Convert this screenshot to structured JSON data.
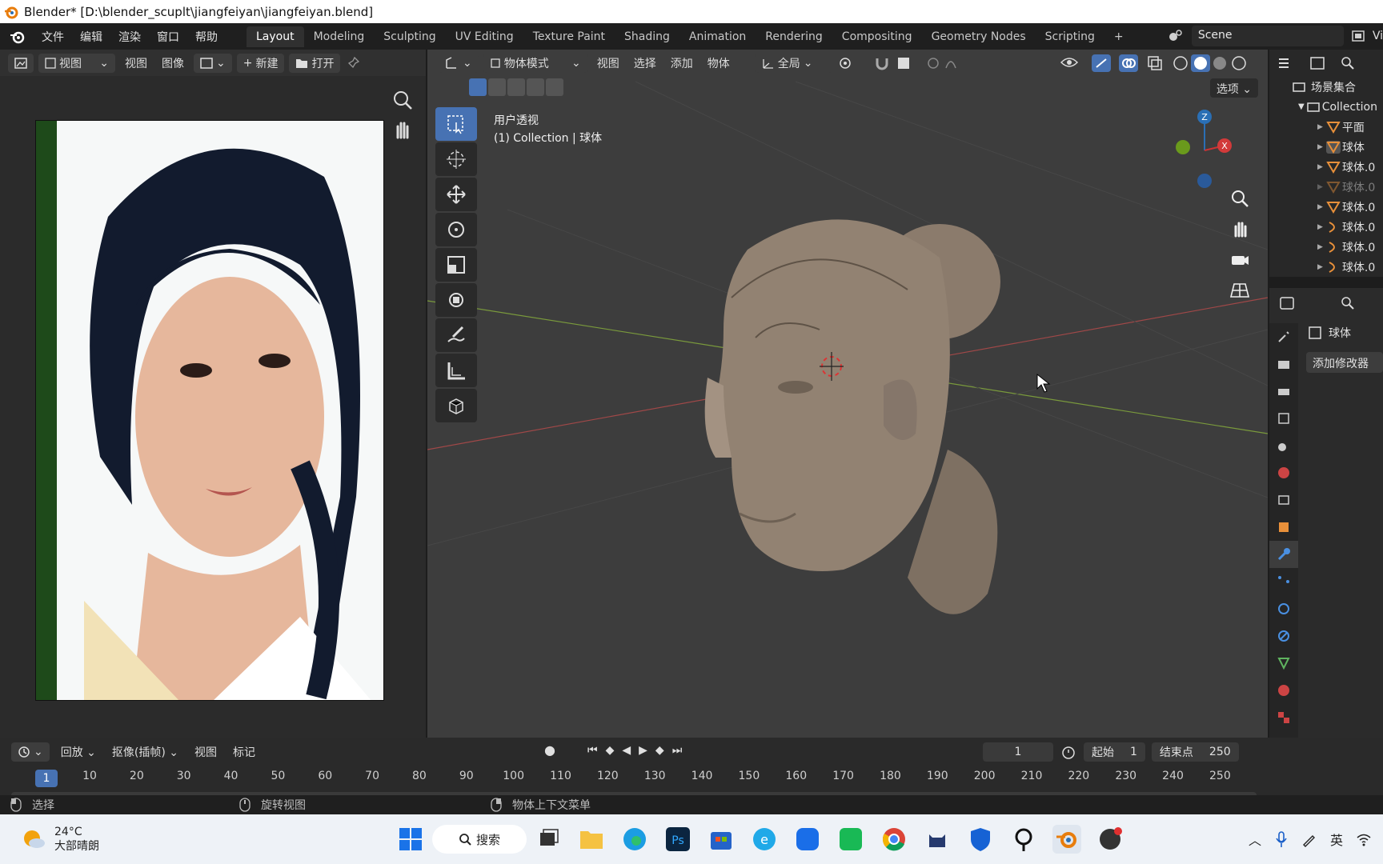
{
  "window": {
    "title": "Blender* [D:\\blender_scuplt\\jiangfeiyan\\jiangfeiyan.blend]"
  },
  "menu": {
    "items": [
      "文件",
      "编辑",
      "渲染",
      "窗口",
      "帮助"
    ]
  },
  "workspaces": [
    {
      "label": "Layout",
      "active": true
    },
    {
      "label": "Modeling"
    },
    {
      "label": "Sculpting"
    },
    {
      "label": "UV Editing"
    },
    {
      "label": "Texture Paint"
    },
    {
      "label": "Shading"
    },
    {
      "label": "Animation"
    },
    {
      "label": "Rendering"
    },
    {
      "label": "Compositing"
    },
    {
      "label": "Geometry Nodes"
    },
    {
      "label": "Scripting"
    }
  ],
  "add_workspace": "+",
  "scene": {
    "name": "Scene",
    "view_layer_partial": "Vi"
  },
  "image_editor": {
    "view_mode": "视图",
    "menus": [
      "视图",
      "图像"
    ],
    "new_label": "新建",
    "open_label": "打开"
  },
  "viewport": {
    "mode": "物体模式",
    "menus": [
      "视图",
      "选择",
      "添加",
      "物体"
    ],
    "transform_orientation": "全局",
    "options_label": "选项",
    "overlay_line1": "用户透视",
    "overlay_line2": "(1) Collection | 球体",
    "gizmo_z": "Z",
    "gizmo_x": "X"
  },
  "outliner": {
    "root": "场景集合",
    "collection": "Collection",
    "items": [
      "平面",
      "球体",
      "球体.0",
      "球体.0",
      "球体.0",
      "球体.0",
      "球体.0",
      "球体.0"
    ]
  },
  "properties": {
    "object_name": "球体",
    "add_modifier": "添加修改器"
  },
  "timeline": {
    "playback": "回放",
    "keying": "抠像(插帧)",
    "menus": [
      "视图",
      "标记"
    ],
    "current_frame": "1",
    "start_label": "起始",
    "start_value": "1",
    "end_label": "结束点",
    "end_value": "250",
    "ruler": [
      "10",
      "20",
      "30",
      "40",
      "50",
      "60",
      "70",
      "80",
      "90",
      "100",
      "110",
      "120",
      "130",
      "140",
      "150",
      "160",
      "170",
      "180",
      "190",
      "200",
      "210",
      "220",
      "230",
      "240",
      "250"
    ]
  },
  "statusbar": {
    "left": "选择",
    "middle": "旋转视图",
    "right": "物体上下文菜单"
  },
  "taskbar": {
    "weather_temp": "24°C",
    "weather_desc": "大部晴朗",
    "search": "搜索",
    "ime": "英"
  }
}
